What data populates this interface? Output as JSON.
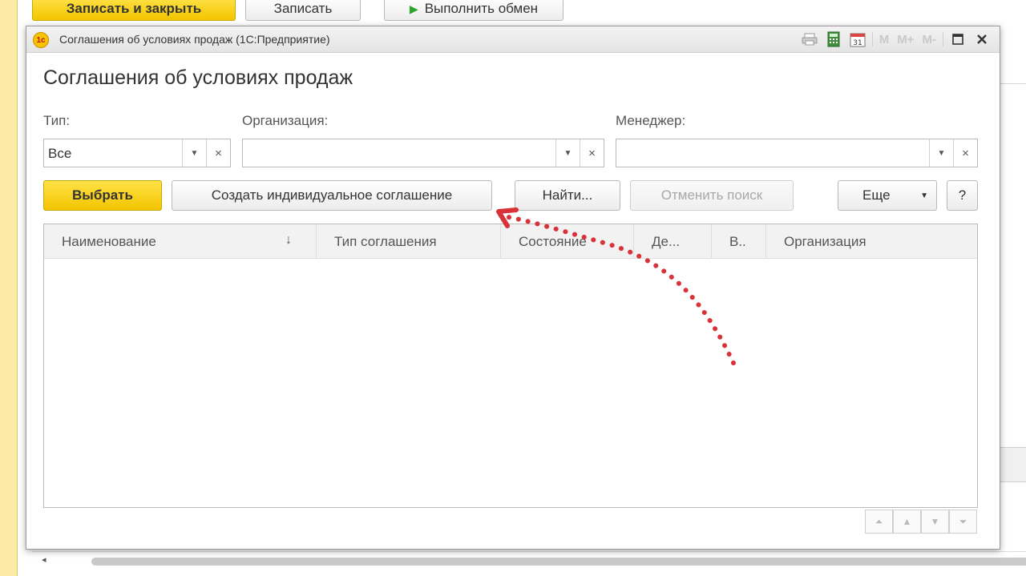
{
  "parent_toolbar": {
    "save_close_label": "Записать и закрыть",
    "save_label": "Записать",
    "exchange_label": "Выполнить обмен"
  },
  "window": {
    "title": "Соглашения об условиях продаж  (1С:Предприятие)",
    "app_icon_text": "1с",
    "toolbar_icons": [
      "print-icon",
      "calculator-icon",
      "calendar-icon"
    ],
    "calendar_day": "31",
    "memory_buttons": [
      "M",
      "M+",
      "M-"
    ]
  },
  "form": {
    "title": "Соглашения об условиях продаж",
    "filters": {
      "type_label": "Тип:",
      "type_value": "Все",
      "organization_label": "Организация:",
      "organization_value": "",
      "manager_label": "Менеджер:",
      "manager_value": ""
    },
    "buttons": {
      "select": "Выбрать",
      "create_individual": "Создать индивидуальное соглашение",
      "find": "Найти...",
      "cancel_search": "Отменить поиск",
      "more": "Еще",
      "help": "?"
    },
    "table": {
      "columns": [
        "Наименование",
        "Тип соглашения",
        "Состояние",
        "Де...",
        "В..",
        "Организация"
      ],
      "sort_indicator": "↓",
      "rows": []
    }
  },
  "annotation": {
    "color": "#d9333a"
  }
}
